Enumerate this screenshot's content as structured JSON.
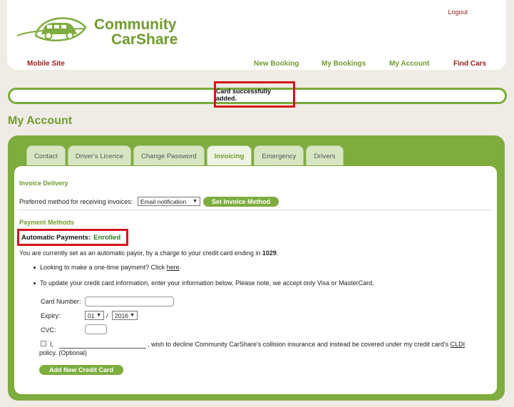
{
  "header": {
    "logo_line1": "Community",
    "logo_line2": "CarShare",
    "logout": "Logout",
    "mobile_site": "Mobile Site",
    "nav": [
      "New Booking",
      "My Bookings",
      "My Account",
      "Find Cars"
    ]
  },
  "status": {
    "message": "Card successfully added."
  },
  "page_title": "My Account",
  "tabs": [
    {
      "label": "Contact"
    },
    {
      "label": "Driver's Licence"
    },
    {
      "label": "Change Password"
    },
    {
      "label": "Invoicing",
      "active": true
    },
    {
      "label": "Emergency"
    },
    {
      "label": "Drivers"
    }
  ],
  "invoice": {
    "title": "Invoice Delivery",
    "pref_label": "Preferred method for receiving invoices:",
    "method_value": "Email notification",
    "set_button": "Set Invoice Method"
  },
  "payment": {
    "title": "Payment Methods",
    "auto_label": "Automatic Payments:",
    "auto_status": "Enrolled",
    "payor_text_prefix": "You are currently set as an automatic payor, by a charge to your credit card ending in ",
    "card_ending": "1029",
    "payor_text_suffix": ".",
    "bullet1_prefix": "Looking to make a one-time payment? Click ",
    "bullet1_link": "here",
    "bullet1_suffix": ".",
    "bullet2": "To update your credit card information, enter your information below. Please note, we accept only Visa or MasterCard."
  },
  "card_form": {
    "card_number_label": "Card Number:",
    "expiry_label": "Expiry:",
    "expiry_month": "01",
    "expiry_sep": "/",
    "expiry_year": "2016",
    "cvc_label": "CVC:",
    "decline_prefix": "I,",
    "decline_text": ", wish to decline Community CarShare's collision insurance and instead be covered under my credit card's ",
    "cldi": "CLDI",
    "decline_line2": "policy. (Optional)",
    "add_button": "Add New Credit Card"
  },
  "colors": {
    "brand_green": "#7eac3e",
    "brand_red": "#9a1d1d",
    "highlight": "#d6131b"
  }
}
